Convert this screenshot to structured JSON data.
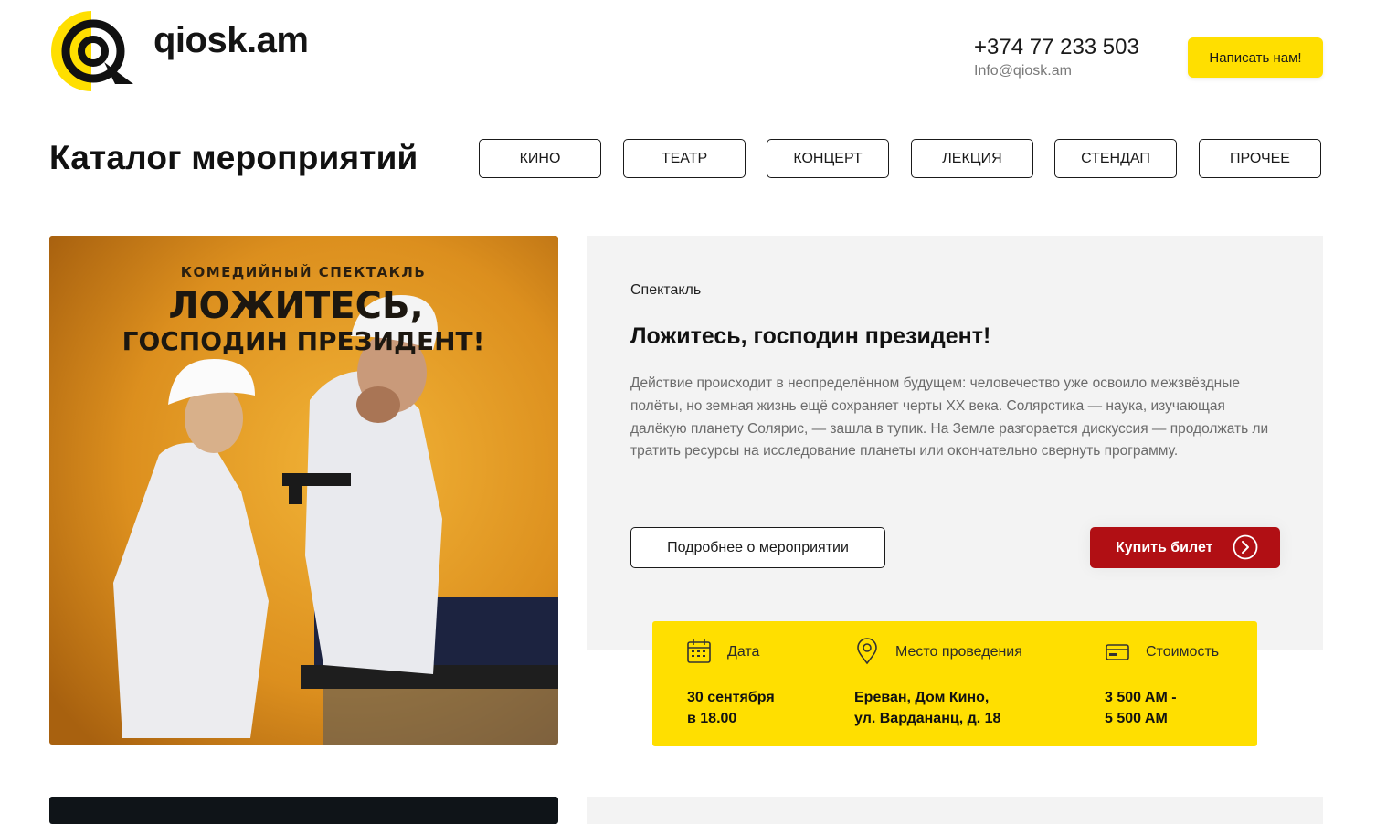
{
  "brand": {
    "name": "qiosk.am"
  },
  "contact": {
    "phone": "+374 77 233 503",
    "email": "Info@qiosk.am"
  },
  "header": {
    "cta_label": "Написать нам!"
  },
  "catalog": {
    "title": "Каталог мероприятий",
    "categories": [
      "КИНО",
      "ТЕАТР",
      "КОНЦЕРТ",
      "ЛЕКЦИЯ",
      "СТЕНДАП",
      "ПРОЧЕЕ"
    ]
  },
  "event": {
    "poster": {
      "line1": "КОМЕДИЙНЫЙ СПЕКТАКЛЬ",
      "line2": "ЛОЖИТЕСЬ,",
      "line3": "ГОСПОДИН ПРЕЗИДЕНТ!"
    },
    "type": "Спектакль",
    "title": "Ложитесь, господин президент!",
    "description": "Действие происходит в неопределённом будущем: человечество уже освоило межзвёздные полёты, но земная жизнь ещё сохраняет черты XX века. Солярстика — наука, изучающая далёкую планету Солярис, — зашла в тупик. На Земле разгорается дискуссия — продолжать ли тратить ресурсы на исследование планеты или окончательно свернуть программу.",
    "more_label": "Подробнее о мероприятии",
    "buy_label": "Купить билет",
    "details": {
      "date_label": "Дата",
      "date_line1": "30 сентября",
      "date_line2": "в 18.00",
      "venue_label": "Место проведения",
      "venue_line1": "Ереван, Дом Кино,",
      "venue_line2": "ул. Вардананц, д. 18",
      "price_label": "Стоимость",
      "price_line1": "3 500 AM -",
      "price_line2": "5 500 AM"
    }
  },
  "colors": {
    "accent": "#FFDF00",
    "buy": "#B10F14",
    "panel": "#F3F3F3"
  }
}
